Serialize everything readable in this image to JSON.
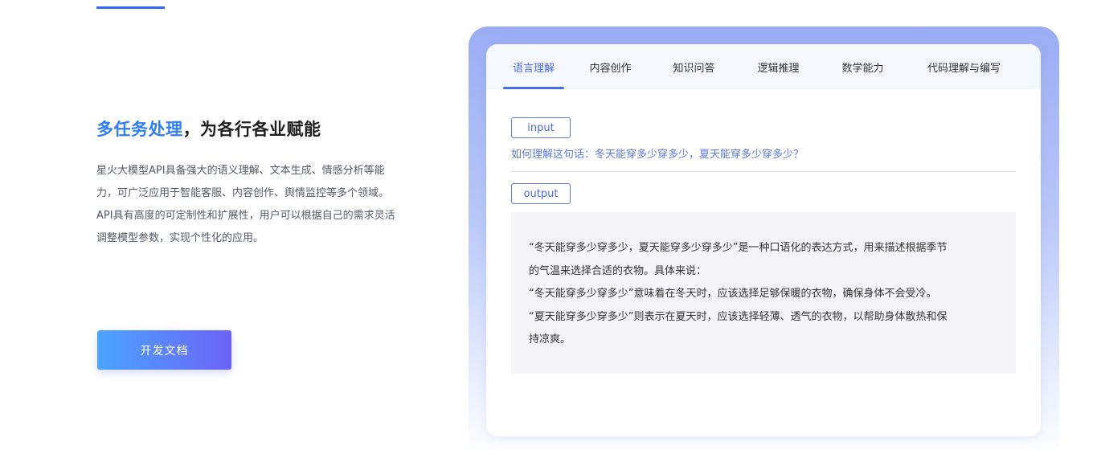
{
  "left": {
    "headline_highlight": "多任务处理",
    "headline_rest": "，为各行各业赋能",
    "description": "星火大模型API具备强大的语义理解、文本生成、情感分析等能力，可广泛应用于智能客服、内容创作、舆情监控等多个领域。API具有高度的可定制性和扩展性，用户可以根据自己的需求灵活调整模型参数，实现个性化的应用。",
    "cta_label": "开发文档"
  },
  "tabs": [
    {
      "label": "语言理解",
      "active": true
    },
    {
      "label": "内容创作",
      "active": false
    },
    {
      "label": "知识问答",
      "active": false
    },
    {
      "label": "逻辑推理",
      "active": false
    },
    {
      "label": "数学能力",
      "active": false
    },
    {
      "label": "代码理解与编写",
      "active": false
    }
  ],
  "demo": {
    "input_tag": "input",
    "question": "如何理解这句话：冬天能穿多少穿多少，夏天能穿多少穿多少？",
    "output_tag": "output",
    "answer_lines": [
      "“冬天能穿多少穿多少，夏天能穿多少穿多少”是一种口语化的表达方式，用来描述根据季节",
      "的气温来选择合适的衣物。具体来说：",
      "“冬天能穿多少穿多少”意味着在冬天时，应该选择足够保暖的衣物，确保身体不会受冷。",
      "“夏天能穿多少穿多少”则表示在夏天时，应该选择轻薄、透气的衣物，以帮助身体散热和保",
      "持凉爽。"
    ]
  },
  "colors": {
    "accent": "#2f7ef5",
    "tab_active": "#4a6be6",
    "cta_start": "#4aa4ff",
    "cta_end": "#6c63f6"
  }
}
